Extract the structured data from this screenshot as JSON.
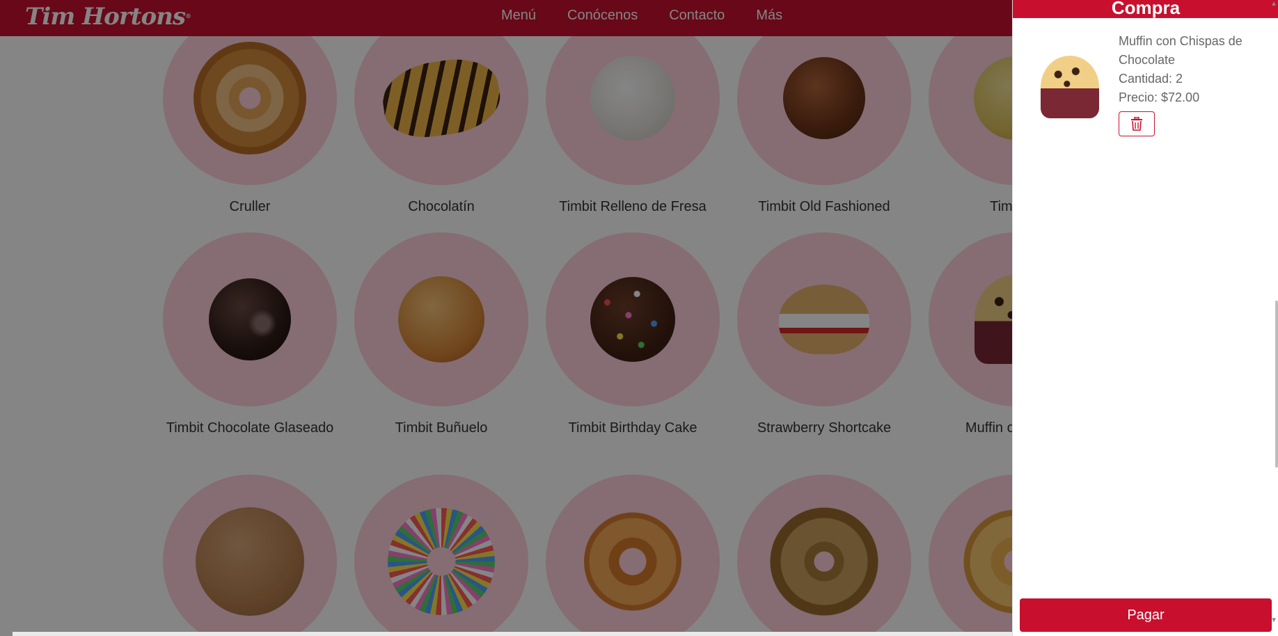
{
  "navbar": {
    "logo_text": "Tim Hortons",
    "logo_mark": "®",
    "links": [
      "Menú",
      "Conócenos",
      "Contacto",
      "Más"
    ]
  },
  "products": [
    {
      "name": "Cruller",
      "image_icon": "cruller-image"
    },
    {
      "name": "Chocolatín",
      "image_icon": "chocolatin-image"
    },
    {
      "name": "Timbit Relleno de Fresa",
      "image_icon": "timbit-image"
    },
    {
      "name": "Timbit Old Fashioned",
      "image_icon": "timbit-image"
    },
    {
      "name": "Timbit H",
      "image_icon": "timbit-image"
    },
    {
      "name": "Timbit Chocolate Glaseado",
      "image_icon": "timbit-image"
    },
    {
      "name": "Timbit Buñuelo",
      "image_icon": "timbit-image"
    },
    {
      "name": "Timbit Birthday Cake",
      "image_icon": "timbit-image"
    },
    {
      "name": "Strawberry Shortcake",
      "image_icon": "shortcake-image"
    },
    {
      "name": "Muffin con Choc",
      "image_icon": "muffin-image"
    },
    {
      "name": "",
      "image_icon": "cookie-image"
    },
    {
      "name": "",
      "image_icon": "donut-image"
    },
    {
      "name": "",
      "image_icon": "donut-image"
    },
    {
      "name": "",
      "image_icon": "donut-image"
    },
    {
      "name": "",
      "image_icon": "donut-image"
    }
  ],
  "cart": {
    "title": "Compra",
    "items": [
      {
        "name": "Muffin con Chispas de Chocolate",
        "quantity_text": "Cantidad: 2",
        "price_text": "Precio: $72.00",
        "image_icon": "muffin-image"
      }
    ],
    "delete_icon": "trash-icon",
    "pay_label": "Pagar"
  },
  "colors": {
    "brand_red": "#c8102e",
    "circle_pink": "#ffd2dc",
    "overlay": "rgba(0,0,0,0.48)"
  }
}
